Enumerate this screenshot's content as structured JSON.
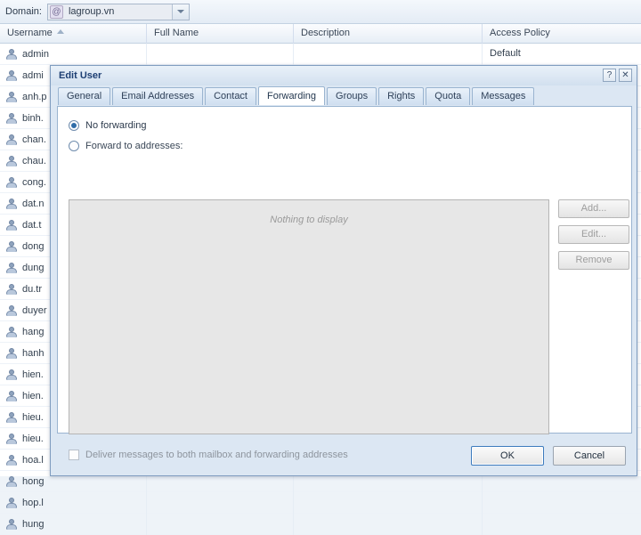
{
  "toolbar": {
    "domain_label": "Domain:",
    "domain_value": "lagroup.vn",
    "domain_icon": "at-sign-icon",
    "dropdown_icon": "chevron-down-icon"
  },
  "grid": {
    "columns": [
      {
        "label": "Username",
        "sorted": "asc"
      },
      {
        "label": "Full Name",
        "sorted": ""
      },
      {
        "label": "Description",
        "sorted": ""
      },
      {
        "label": "Access Policy",
        "sorted": ""
      }
    ],
    "rows": [
      {
        "username": "admin",
        "full_name": "",
        "description": "",
        "access_policy": "Default"
      },
      {
        "username": "admi",
        "full_name": "",
        "description": "",
        "access_policy": ""
      },
      {
        "username": "anh.p",
        "full_name": "",
        "description": "",
        "access_policy": ""
      },
      {
        "username": "binh.",
        "full_name": "",
        "description": "",
        "access_policy": ""
      },
      {
        "username": "chan.",
        "full_name": "",
        "description": "",
        "access_policy": ""
      },
      {
        "username": "chau.",
        "full_name": "",
        "description": "",
        "access_policy": ""
      },
      {
        "username": "cong.",
        "full_name": "",
        "description": "",
        "access_policy": ""
      },
      {
        "username": "dat.n",
        "full_name": "",
        "description": "",
        "access_policy": ""
      },
      {
        "username": "dat.t",
        "full_name": "",
        "description": "",
        "access_policy": ""
      },
      {
        "username": "dong",
        "full_name": "",
        "description": "",
        "access_policy": ""
      },
      {
        "username": "dung",
        "full_name": "",
        "description": "",
        "access_policy": ""
      },
      {
        "username": "du.tr",
        "full_name": "",
        "description": "",
        "access_policy": ""
      },
      {
        "username": "duyer",
        "full_name": "",
        "description": "",
        "access_policy": ""
      },
      {
        "username": "hang",
        "full_name": "",
        "description": "",
        "access_policy": ""
      },
      {
        "username": "hanh",
        "full_name": "",
        "description": "",
        "access_policy": ""
      },
      {
        "username": "hien.",
        "full_name": "",
        "description": "",
        "access_policy": ""
      },
      {
        "username": "hien.",
        "full_name": "",
        "description": "",
        "access_policy": ""
      },
      {
        "username": "hieu.",
        "full_name": "",
        "description": "",
        "access_policy": ""
      },
      {
        "username": "hieu.",
        "full_name": "",
        "description": "",
        "access_policy": ""
      },
      {
        "username": "hoa.l",
        "full_name": "",
        "description": "",
        "access_policy": ""
      },
      {
        "username": "hong",
        "full_name": "",
        "description": "",
        "access_policy": ""
      },
      {
        "username": "hop.l",
        "full_name": "",
        "description": "",
        "access_policy": ""
      },
      {
        "username": "hung",
        "full_name": "",
        "description": "",
        "access_policy": ""
      }
    ]
  },
  "dialog": {
    "title": "Edit User",
    "help_icon": "question-mark-icon",
    "close_icon": "close-icon",
    "tabs": [
      {
        "label": "General",
        "active": false
      },
      {
        "label": "Email Addresses",
        "active": false
      },
      {
        "label": "Contact",
        "active": false
      },
      {
        "label": "Forwarding",
        "active": true
      },
      {
        "label": "Groups",
        "active": false
      },
      {
        "label": "Rights",
        "active": false
      },
      {
        "label": "Quota",
        "active": false
      },
      {
        "label": "Messages",
        "active": false
      }
    ],
    "forwarding": {
      "option_no_forwarding": "No forwarding",
      "option_forward_to": "Forward to addresses:",
      "selected_option": "No forwarding",
      "empty_list_text": "Nothing to display",
      "add_label": "Add...",
      "edit_label": "Edit...",
      "remove_label": "Remove",
      "deliver_both_label": "Deliver messages to both mailbox and forwarding addresses",
      "deliver_both_checked": false
    },
    "footer": {
      "ok_label": "OK",
      "cancel_label": "Cancel"
    }
  },
  "colors": {
    "accent": "#2f6ca8",
    "title_text": "#1d3f73",
    "dialog_chrome": "#dce7f3",
    "app_background": "#eef3f8"
  }
}
